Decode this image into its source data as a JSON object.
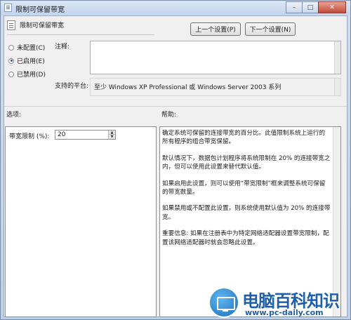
{
  "window": {
    "title": "限制可保留带宽",
    "minimize_glyph": "–",
    "maximize_glyph": "□",
    "close_glyph": "✕"
  },
  "header": {
    "policy_title": "限制可保留带宽",
    "prev_button": "上一个设置(P)",
    "next_button": "下一个设置(N)"
  },
  "state": {
    "options": [
      {
        "label": "未配置(C)",
        "checked": false
      },
      {
        "label": "已启用(E)",
        "checked": true
      },
      {
        "label": "已禁用(D)",
        "checked": false
      }
    ]
  },
  "comment": {
    "label": "注释:",
    "value": ""
  },
  "platform": {
    "label": "支持的平台:",
    "value": "至少 Windows XP Professional 或 Windows Server 2003 系列"
  },
  "options_section": {
    "label": "选项:",
    "bandwidth_label": "带宽限制 (%):",
    "bandwidth_value": "20"
  },
  "help_section": {
    "label": "帮助:",
    "paragraphs": [
      "确定系统可保留的连接带宽的百分比。此值限制系统上运行的所有程序的组合带宽保留。",
      "默认情况下，数据包计划程序将系统限制在 20% 的连接带宽之内，但可以使用此设置来替代默认值。",
      "如果启用此设置，则可以使用“带宽限制”框来调整系统可保留的带宽数量。",
      "如果禁用或不配置此设置，则系统使用默认值为 20% 的连接带宽。",
      "重要信息: 如果在注册表中为特定网络适配器设置带宽限制，配置该网络适配器时就会忽略此设置。"
    ]
  },
  "watermark": {
    "title": "电脑百科知识",
    "url": "www.pc-daily.com"
  }
}
